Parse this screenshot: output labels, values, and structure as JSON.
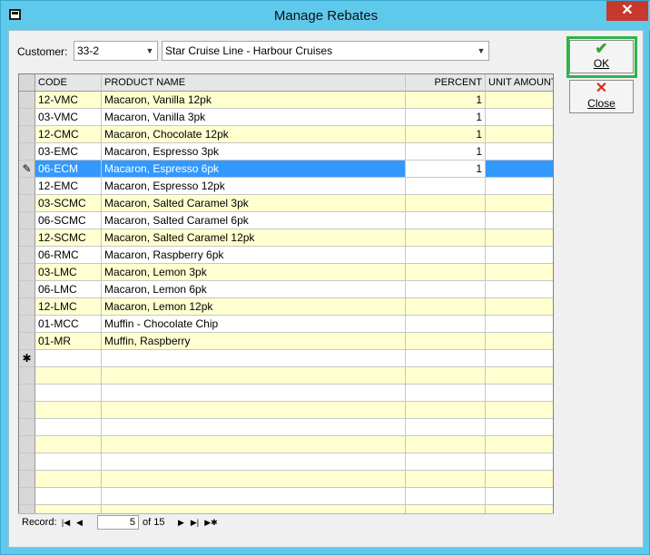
{
  "window": {
    "title": "Manage Rebates",
    "close_glyph": "✕"
  },
  "customer": {
    "label": "Customer:",
    "code": "33-2",
    "name": "Star Cruise Line - Harbour Cruises"
  },
  "buttons": {
    "ok_label": "OK",
    "close_label": "Close",
    "ok_icon": "checkmark-icon",
    "close_icon": "x-icon"
  },
  "grid": {
    "columns": [
      "CODE",
      "PRODUCT NAME",
      "PERCENT",
      "UNIT AMOUNT"
    ],
    "rows": [
      {
        "code": "12-VMC",
        "name": "Macaron, Vanilla 12pk",
        "percent": "1",
        "unit": ""
      },
      {
        "code": "03-VMC",
        "name": "Macaron, Vanilla 3pk",
        "percent": "1",
        "unit": ""
      },
      {
        "code": "12-CMC",
        "name": "Macaron, Chocolate 12pk",
        "percent": "1",
        "unit": ""
      },
      {
        "code": "03-EMC",
        "name": "Macaron, Espresso 3pk",
        "percent": "1",
        "unit": ""
      },
      {
        "code": "06-ECM",
        "name": "Macaron, Espresso 6pk",
        "percent": "1",
        "unit": ""
      },
      {
        "code": "12-EMC",
        "name": "Macaron, Espresso 12pk",
        "percent": "",
        "unit": ""
      },
      {
        "code": "03-SCMC",
        "name": "Macaron, Salted Caramel 3pk",
        "percent": "",
        "unit": ""
      },
      {
        "code": "06-SCMC",
        "name": "Macaron, Salted Caramel 6pk",
        "percent": "",
        "unit": ""
      },
      {
        "code": "12-SCMC",
        "name": "Macaron, Salted Caramel 12pk",
        "percent": "",
        "unit": ""
      },
      {
        "code": "06-RMC",
        "name": "Macaron, Raspberry 6pk",
        "percent": "",
        "unit": ""
      },
      {
        "code": "03-LMC",
        "name": "Macaron, Lemon 3pk",
        "percent": "",
        "unit": ""
      },
      {
        "code": "06-LMC",
        "name": "Macaron, Lemon 6pk",
        "percent": "",
        "unit": ""
      },
      {
        "code": "12-LMC",
        "name": "Macaron, Lemon 12pk",
        "percent": "",
        "unit": ""
      },
      {
        "code": "01-MCC",
        "name": "Muffin - Chocolate Chip",
        "percent": "",
        "unit": ""
      },
      {
        "code": "01-MR",
        "name": "Muffin, Raspberry",
        "percent": "",
        "unit": ""
      }
    ],
    "selected_row_index": 4,
    "edit_glyph": "✎",
    "new_row_glyph": "✱"
  },
  "navigator": {
    "label": "Record:",
    "current": "5",
    "of_text": "of 15",
    "glyphs": {
      "first": "|◀",
      "prev": "◀",
      "next": "▶",
      "last": "▶|",
      "new": "▶✱"
    }
  },
  "colors": {
    "title_bar": "#5fc9ec",
    "row_alt": "#ffffd0",
    "selection": "#3399ff",
    "ok_highlight": "#2fb34a"
  }
}
